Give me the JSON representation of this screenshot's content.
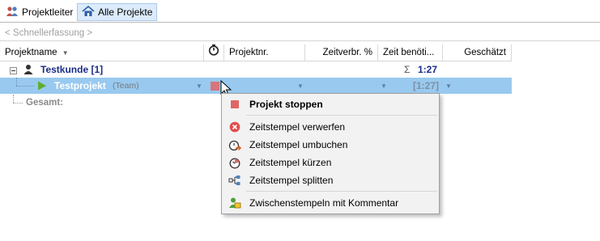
{
  "tabs": [
    {
      "label": "Projektleiter",
      "icon": "people-icon",
      "active": false
    },
    {
      "label": "Alle Projekte",
      "icon": "home-icon",
      "active": true
    }
  ],
  "quick_entry": {
    "placeholder": "< Schnellerfassung >"
  },
  "columns": {
    "projectname": "Projektname",
    "timer_icon": "stopwatch-icon",
    "project_number": "Projektnr.",
    "time_percent": "Zeitverbr. %",
    "time_needed": "Zeit benöti...",
    "estimated": "Geschätzt"
  },
  "rows": {
    "customer": {
      "name": "Testkunde [1]",
      "sum_symbol": "Σ",
      "time": "1:27"
    },
    "project": {
      "name": "Testprojekt",
      "tag": "(Team)",
      "time": "[1:27]"
    },
    "total": {
      "label": "Gesamt:"
    }
  },
  "context_menu": {
    "items": [
      {
        "label": "Projekt stoppen",
        "icon": "stop-icon",
        "bold": true
      },
      {
        "label": "Zeitstempel verwerfen",
        "icon": "discard-icon"
      },
      {
        "label": "Zeitstempel umbuchen",
        "icon": "rebook-icon"
      },
      {
        "label": "Zeitstempel kürzen",
        "icon": "shorten-icon"
      },
      {
        "label": "Zeitstempel splitten",
        "icon": "split-icon"
      },
      {
        "label": "Zwischenstempeln mit Kommentar",
        "icon": "comment-stamp-icon"
      }
    ]
  },
  "colors": {
    "selected_row": "#99c9ef",
    "customer_text": "#1a2b86",
    "stop_red": "#e06666",
    "discard_red": "#e04b4b",
    "play_green": "#5fae2e"
  }
}
